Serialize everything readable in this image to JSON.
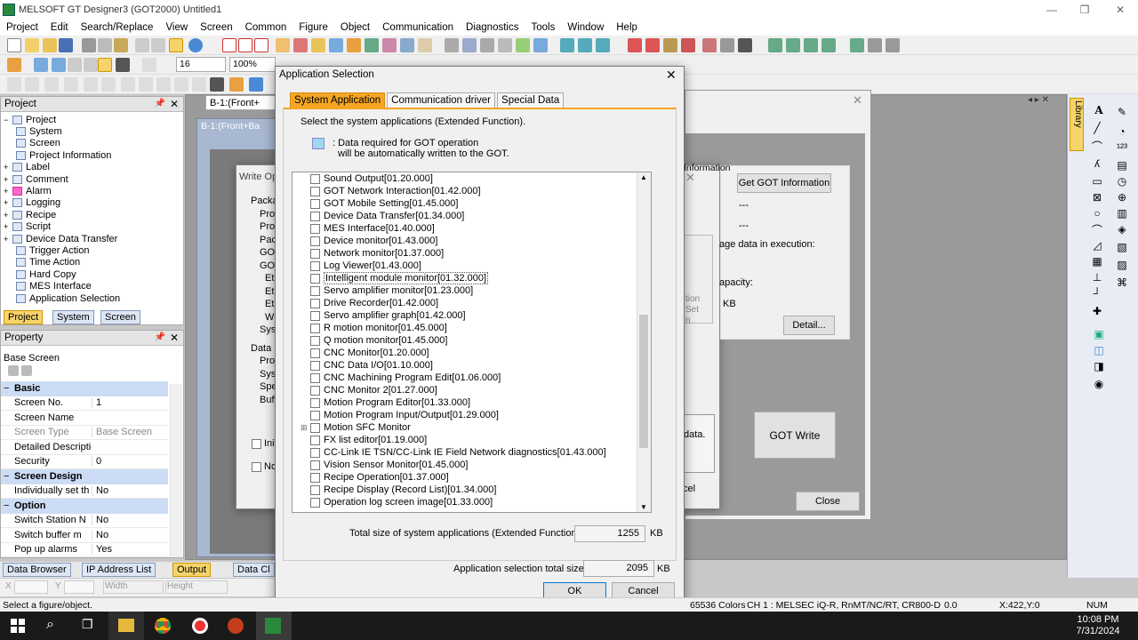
{
  "window": {
    "title": "MELSOFT GT Designer3 (GOT2000) Untitled1"
  },
  "menu": [
    "Project",
    "Edit",
    "Search/Replace",
    "View",
    "Screen",
    "Common",
    "Figure",
    "Object",
    "Communication",
    "Diagnostics",
    "Tools",
    "Window",
    "Help"
  ],
  "toolbar": {
    "font_size": "16",
    "zoom": "100%",
    "font_size2": "16",
    "value_zero": "0"
  },
  "project_panel": {
    "title": "Project",
    "items": [
      "Project",
      "System",
      "Screen",
      "Project Information",
      "Label",
      "Comment",
      "Alarm",
      "Logging",
      "Recipe",
      "Script",
      "Device Data Transfer",
      "Trigger Action",
      "Time Action",
      "Hard Copy",
      "MES Interface",
      "Application Selection"
    ],
    "tabs": [
      "Project",
      "System",
      "Screen"
    ]
  },
  "property_panel": {
    "title": "Property",
    "object": "Base Screen",
    "sections": {
      "basic": "Basic",
      "screen_design": "Screen Design",
      "option": "Option"
    },
    "rows": [
      {
        "k": "Screen No.",
        "v": "1"
      },
      {
        "k": "Screen Name",
        "v": ""
      },
      {
        "k": "Screen Type",
        "v": "Base Screen"
      },
      {
        "k": "Detailed Description",
        "v": ""
      },
      {
        "k": "Security",
        "v": "0"
      },
      {
        "k": "Individually set th",
        "v": "No"
      },
      {
        "k": "Switch Station N",
        "v": "No"
      },
      {
        "k": "Switch buffer m",
        "v": "No"
      },
      {
        "k": "Pop up alarms",
        "v": "Yes"
      }
    ]
  },
  "bottom_tabs": [
    "Data Browser",
    "IP Address List",
    "Output",
    "Data Cl"
  ],
  "coord_fields": {
    "x": "X",
    "y": "Y",
    "width": "Width",
    "height": "Height"
  },
  "screen_tab": "B-1:(Front+",
  "inner_window_title": "B-1:(Front+Ba",
  "write_dialog": {
    "title": "Write Op",
    "labels": [
      "Packa",
      "Proj",
      "Proj",
      "Pack",
      "GOT",
      "GOT",
      "Eth",
      "Eth",
      "Eth",
      "Wi",
      "Syst",
      "Data S",
      "Proj",
      "Syst",
      "Spe",
      "Buff",
      "Init",
      "No"
    ],
    "get_info_partial": "Information",
    "get_info_btn": "Get GOT Information",
    "dash1": "---",
    "dash2": "---",
    "storage": "age data in execution:",
    "capacity": "apacity:",
    "kb": "KB",
    "detail_btn": "Detail...",
    "data_text": "data.",
    "cancel_partial": "cel",
    "got_write": "GOT Write",
    "close": "Close",
    "middle_text": [
      "tion",
      "Set",
      "n"
    ]
  },
  "app_selection": {
    "title": "Application Selection",
    "tabs": [
      "System Application",
      "Communication driver",
      "Special Data"
    ],
    "instruction": "Select the system applications (Extended Function).",
    "legend_line1": ": Data required for GOT operation",
    "legend_line2": "will be automatically written to the GOT.",
    "items": [
      "Sound Output[01.20.000]",
      "GOT Network Interaction[01.42.000]",
      "GOT Mobile Setting[01.45.000]",
      "Device Data Transfer[01.34.000]",
      "MES Interface[01.40.000]",
      "Device monitor[01.43.000]",
      "Network monitor[01.37.000]",
      "Log Viewer[01.43.000]",
      "Intelligent module monitor[01.32.000]",
      "Servo amplifier monitor[01.23.000]",
      "Drive Recorder[01.42.000]",
      "Servo amplifier graph[01.42.000]",
      "R motion monitor[01.45.000]",
      "Q motion monitor[01.45.000]",
      "CNC Monitor[01.20.000]",
      "CNC Data I/O[01.10.000]",
      "CNC Machining Program Edit[01.06.000]",
      "CNC Monitor 2[01.27.000]",
      "Motion Program Editor[01.33.000]",
      "Motion Program Input/Output[01.29.000]",
      "Motion SFC Monitor",
      "FX list editor[01.19.000]",
      "CC-Link IE TSN/CC-Link IE Field Network diagnostics[01.43.000]",
      "Vision Sensor Monitor[01.45.000]",
      "Recipe Operation[01.37.000]",
      "Recipe Display (Record List)[01.34.000]",
      "Operation log screen image[01.33.000]"
    ],
    "total_label": "Total size of system applications (Extended Function):",
    "total_value": "1255",
    "total_unit": "KB",
    "sel_label": "Application selection total size:",
    "sel_value": "2095",
    "sel_unit": "KB",
    "ok": "OK",
    "cancel": "Cancel"
  },
  "right_toolbar": {
    "library": "Library"
  },
  "status": {
    "left": "Select a figure/object.",
    "colors": "65536 Colors",
    "ch": "CH 1 : MELSEC iQ-R, RnMT/NC/RT, CR800-D",
    "zero": "0.0",
    "xy": "X:422,Y:0",
    "num": "NUM"
  },
  "taskbar": {
    "time": "10:08 PM",
    "date": "7/31/2024"
  },
  "colors": {
    "accent": "#f5a623",
    "legend_swatch": "#9fd8ee",
    "title_bar": "#ffffff",
    "taskbar": "#1a1a1a"
  }
}
